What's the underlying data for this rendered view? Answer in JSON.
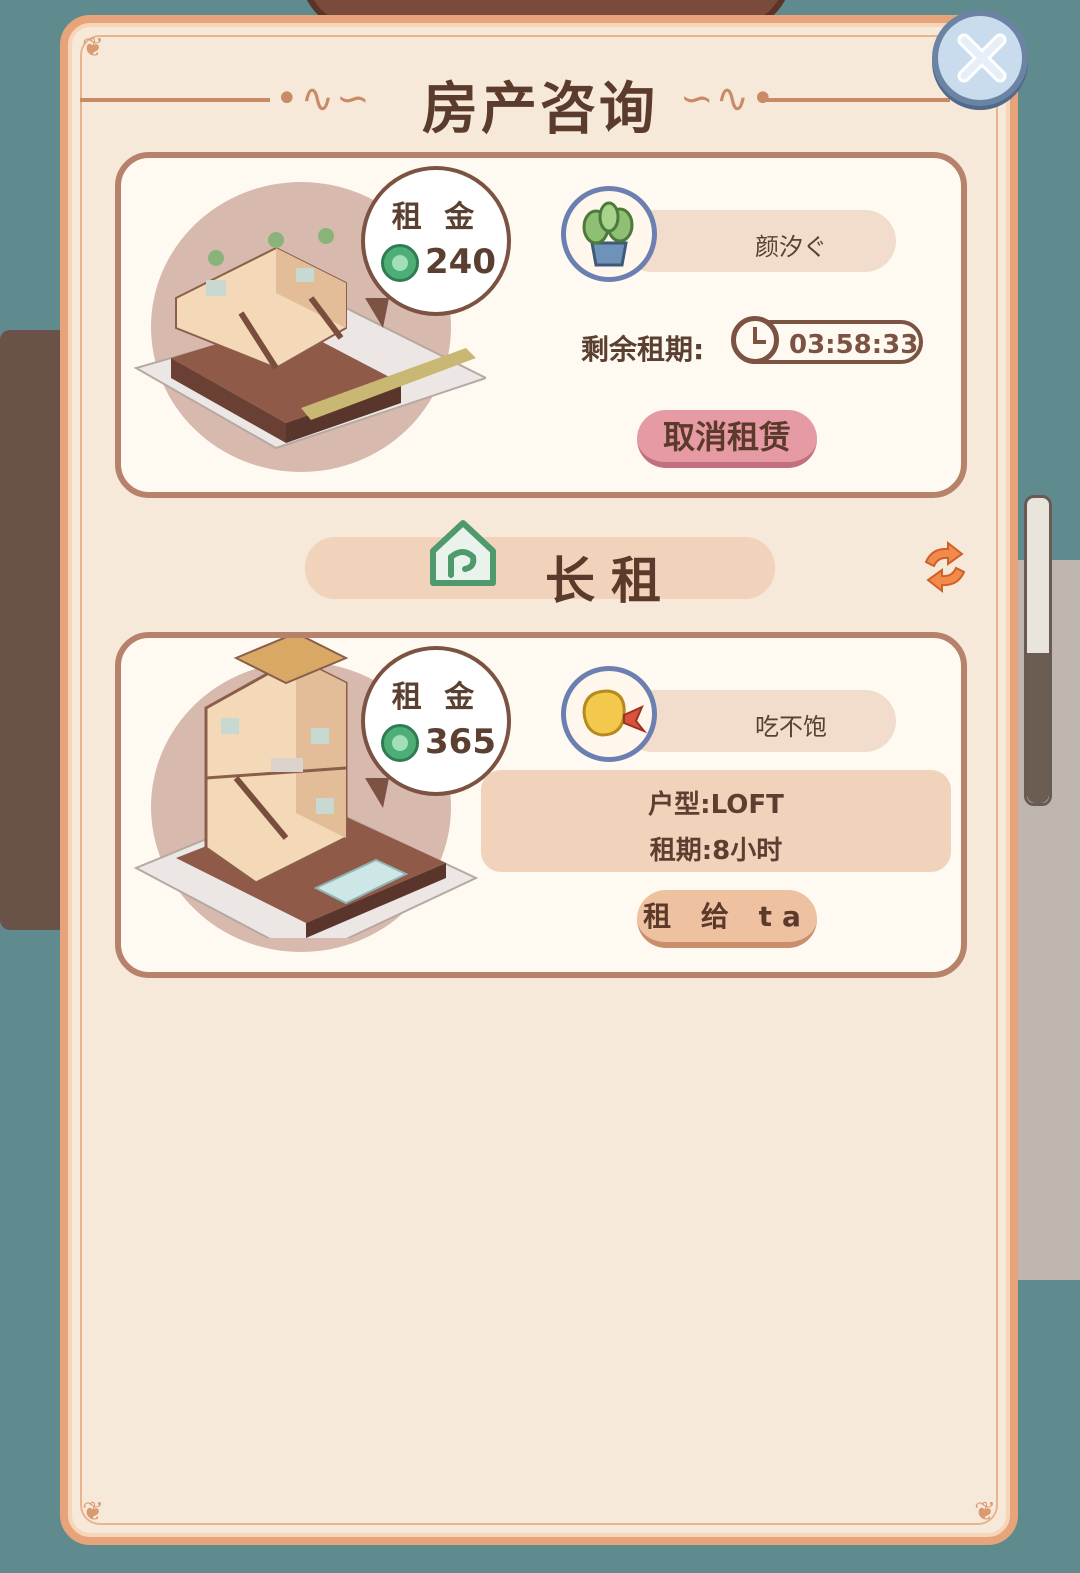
{
  "title": "房产咨询",
  "colors": {
    "panel_bg": "#f7e9d9",
    "panel_border": "#e7a37a",
    "card_border": "#b7826c",
    "cancel_button": "#e59aa4",
    "rent_button": "#eec2a0",
    "coin": "#4fae76"
  },
  "current_rental": {
    "rent_label": "租 金",
    "rent_amount": "240",
    "tenant_name": "颜汐ぐ",
    "remaining_label": "剩余租期:",
    "remaining_time": "03:58:33",
    "cancel_label": "取消租赁"
  },
  "section": {
    "title": "长租",
    "icon": "home-icon",
    "refresh_icon": "refresh-icon"
  },
  "offer": {
    "rent_label": "租 金",
    "rent_amount": "365",
    "tenant_name": "吃不饱",
    "layout_line": "户型:LOFT",
    "term_line": "租期:8小时",
    "rent_button_label": "租 给 ta"
  }
}
